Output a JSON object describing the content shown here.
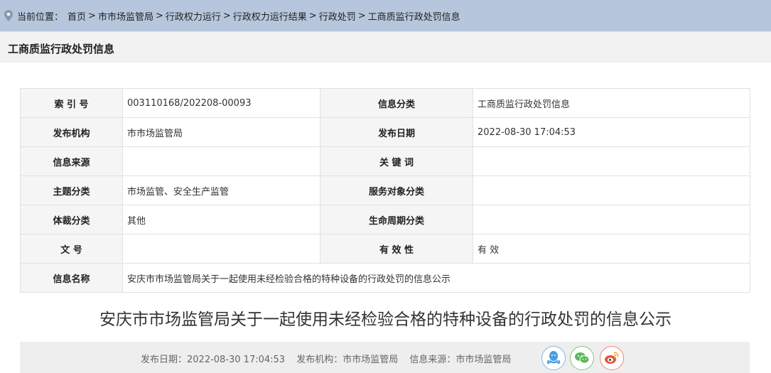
{
  "breadcrumb": {
    "prefix": "当前位置：",
    "items": [
      "首页",
      "市市场监管局",
      "行政权力运行",
      "行政权力运行结果",
      "行政处罚",
      "工商质监行政处罚信息"
    ],
    "separators": [
      " > ",
      " > ",
      " > ",
      "> ",
      "> "
    ]
  },
  "section_title": "工商质监行政处罚信息",
  "meta": {
    "index_label": "索 引 号",
    "index_value": "003110168/202208-00093",
    "category_label": "信息分类",
    "category_value": "工商质监行政处罚信息",
    "publisher_label": "发布机构",
    "publisher_value": "市市场监管局",
    "date_label": "发布日期",
    "date_value": "2022-08-30 17:04:53",
    "source_label": "信息来源",
    "source_value": "",
    "keywords_label": "关 键 词",
    "keywords_value": "",
    "topic_label": "主题分类",
    "topic_value": "市场监管、安全生产监管",
    "service_label": "服务对象分类",
    "service_value": "",
    "genre_label": "体裁分类",
    "genre_value": "其他",
    "lifecycle_label": "生命周期分类",
    "lifecycle_value": "",
    "docno_label": "文 号",
    "docno_value": "",
    "validity_label": "有 效 性",
    "validity_value": "有 效",
    "name_label": "信息名称",
    "name_value": "安庆市市场监管局关于一起使用未经检验合格的特种设备的行政处罚的信息公示"
  },
  "article_title": "安庆市市场监管局关于一起使用未经检验合格的特种设备的行政处罚的信息公示",
  "info_bar": {
    "date": "发布日期：2022-08-30 17:04:53",
    "publisher": "发布机构：市市场监管局",
    "source": "信息来源：市市场监管局"
  },
  "share_icons": [
    "qq-icon",
    "wechat-icon",
    "weibo-icon"
  ],
  "colors": {
    "breadcrumb_bg": "#b6c6dc",
    "header_bg": "#f2f2f2",
    "key_cell_bg": "#f5f5f5"
  }
}
